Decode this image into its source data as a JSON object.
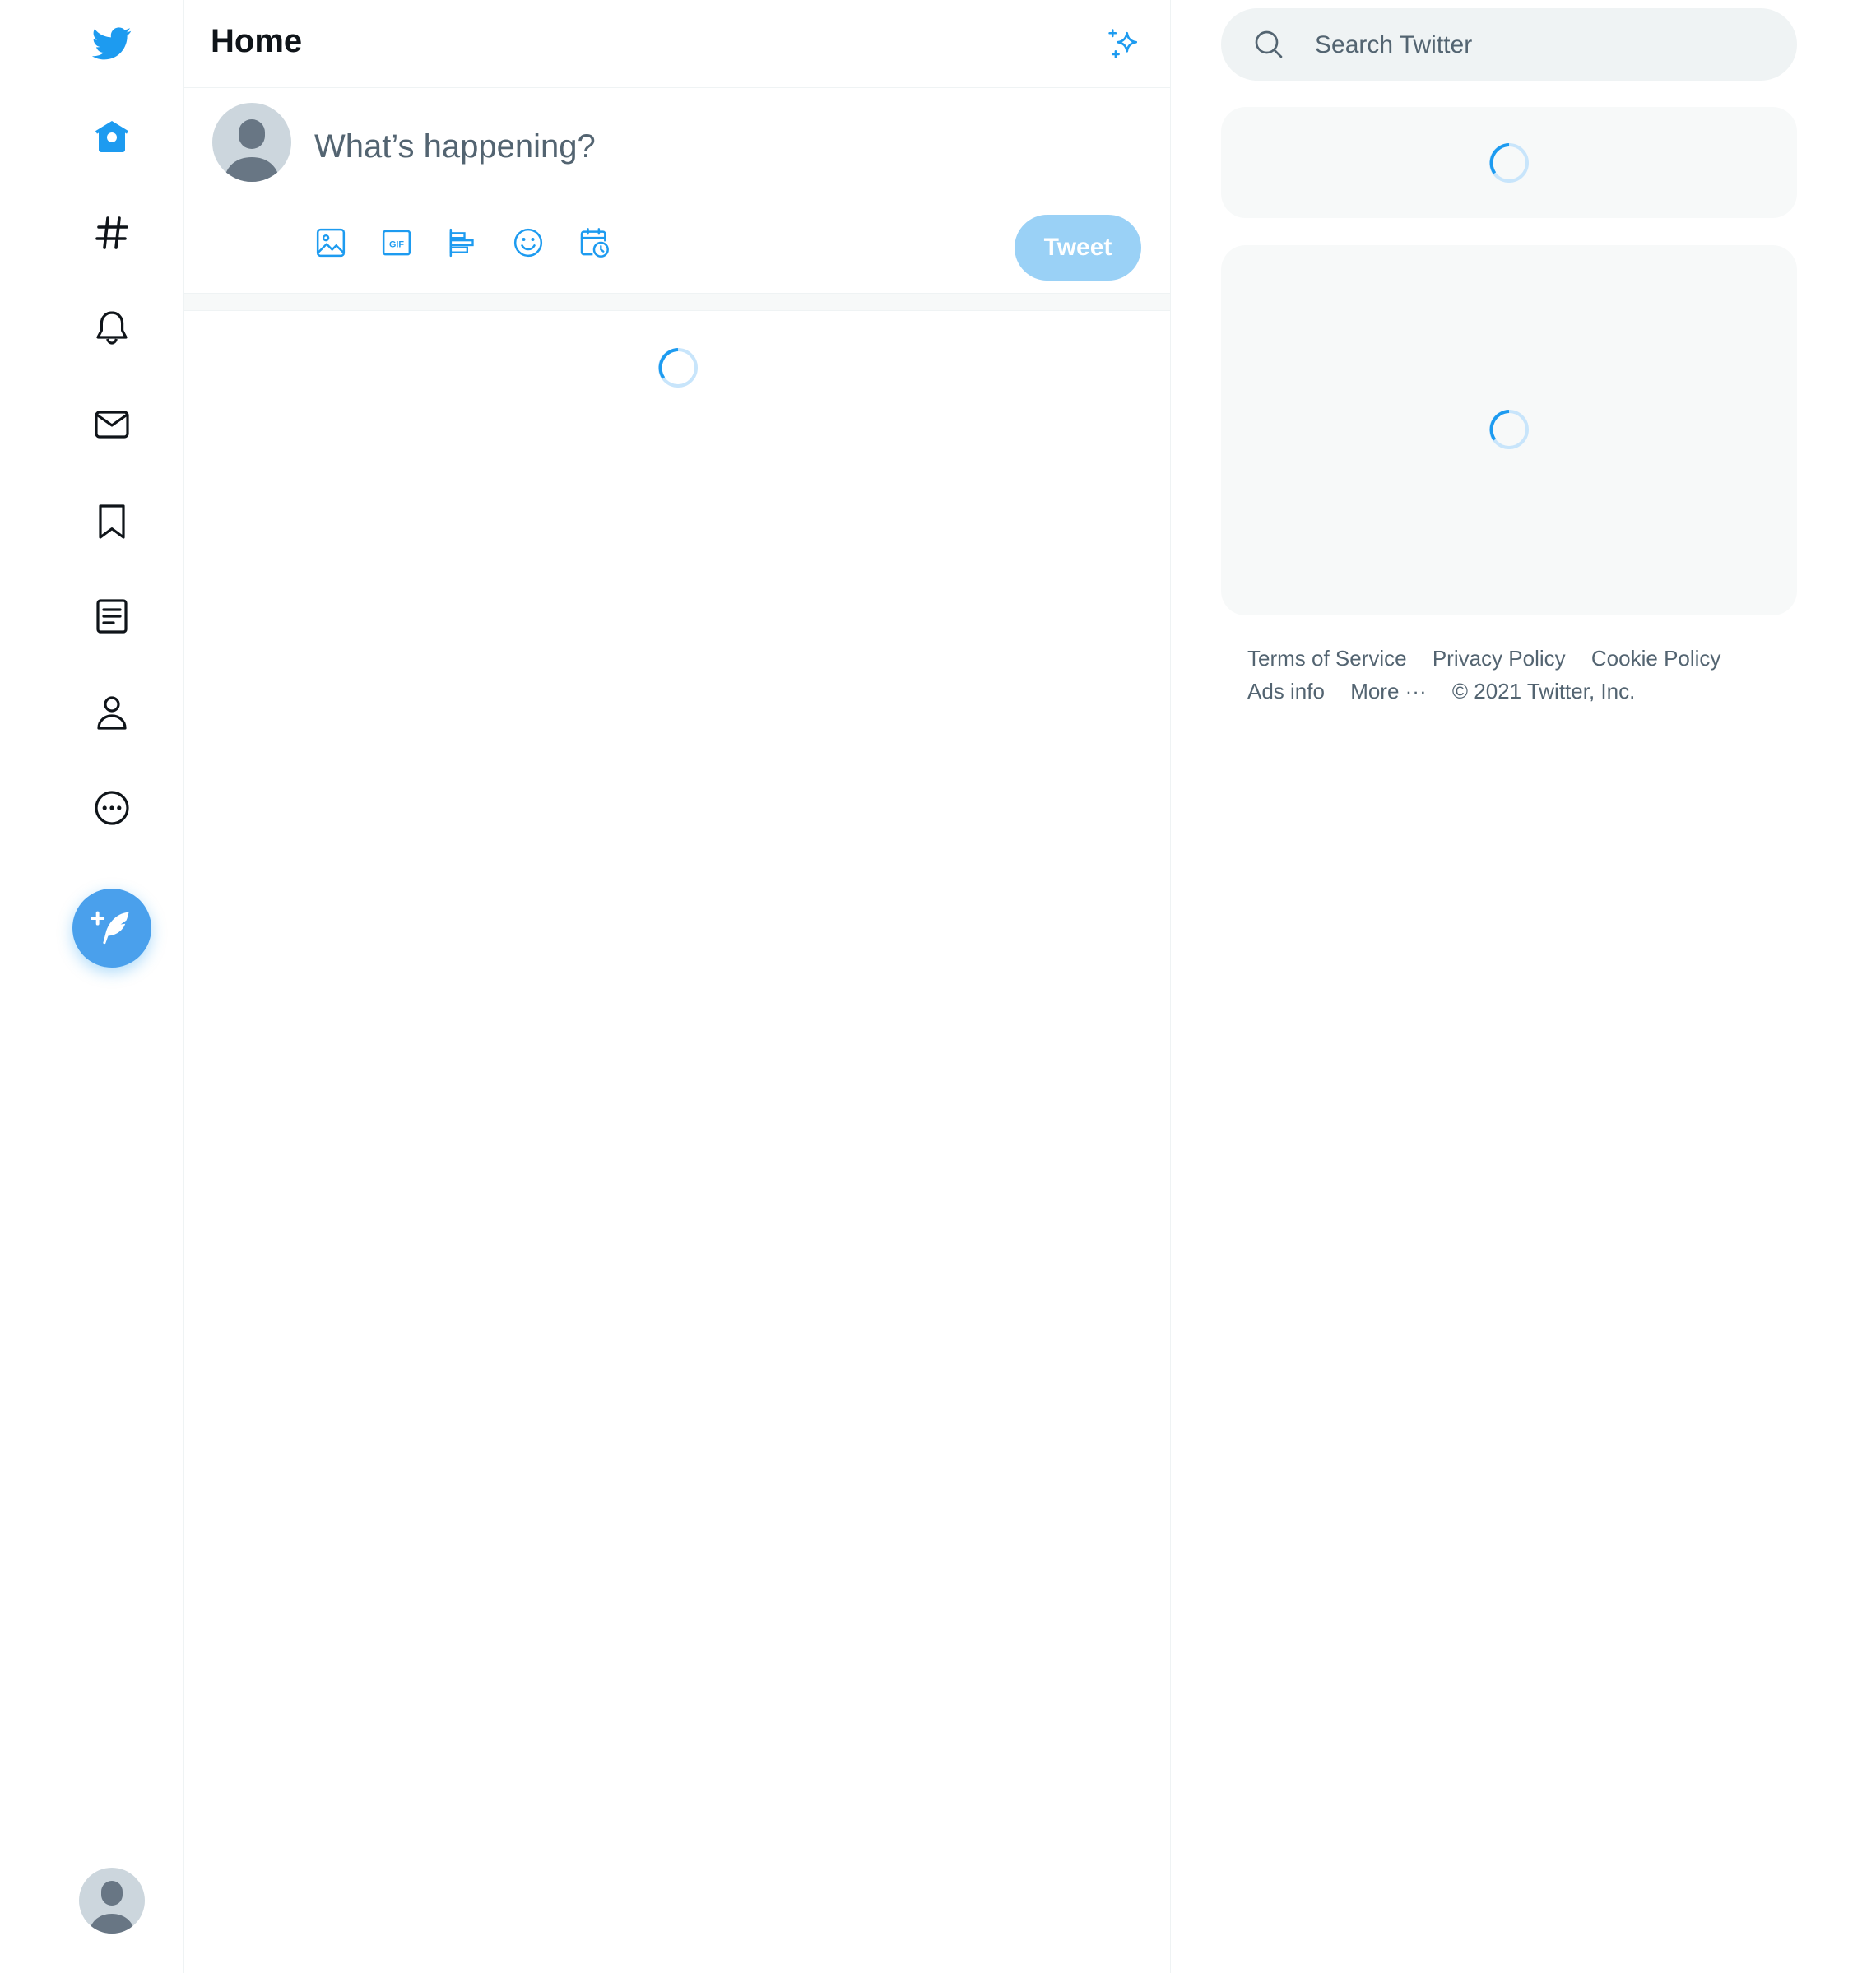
{
  "colors": {
    "accent": "#1d9bf0",
    "accent_light": "#9ad1f6",
    "text_secondary": "#536471"
  },
  "sidebar": {
    "logo": "twitter-bird-icon",
    "items": [
      {
        "name": "home",
        "icon": "home-icon"
      },
      {
        "name": "explore",
        "icon": "hashtag-icon"
      },
      {
        "name": "notifications",
        "icon": "bell-icon"
      },
      {
        "name": "messages",
        "icon": "envelope-icon"
      },
      {
        "name": "bookmarks",
        "icon": "bookmark-icon"
      },
      {
        "name": "lists",
        "icon": "list-icon"
      },
      {
        "name": "profile",
        "icon": "person-icon"
      },
      {
        "name": "more",
        "icon": "more-circle-icon"
      }
    ],
    "compose_icon": "feather-plus-icon"
  },
  "header": {
    "title": "Home",
    "top_tweets_icon": "sparkle-icon"
  },
  "composer": {
    "placeholder": "What’s happening?",
    "tools": [
      "image-icon",
      "gif-icon",
      "poll-icon",
      "emoji-icon",
      "schedule-icon"
    ],
    "gif_label": "GIF",
    "tweet_button": "Tweet"
  },
  "search": {
    "placeholder": "Search Twitter"
  },
  "footer": {
    "links": [
      "Terms of Service",
      "Privacy Policy",
      "Cookie Policy",
      "Ads info",
      "More ···"
    ],
    "copyright": "© 2021 Twitter, Inc."
  }
}
